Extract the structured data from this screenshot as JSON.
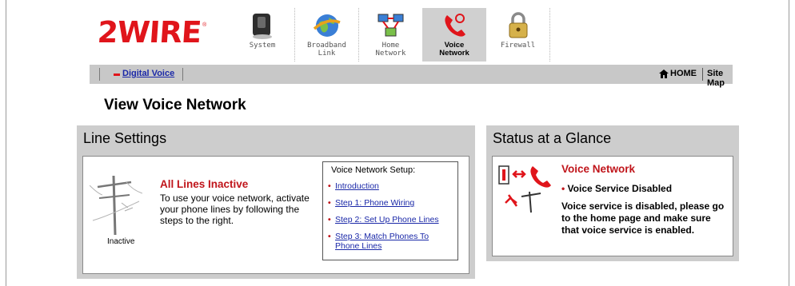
{
  "brand": {
    "logo_text": "2WIRE",
    "registered_mark": "®",
    "accent_color": "#e0151b"
  },
  "nav": {
    "tabs": [
      {
        "label_line1": "System",
        "label_line2": "",
        "icon": "system-icon",
        "active": false
      },
      {
        "label_line1": "Broadband",
        "label_line2": "Link",
        "icon": "globe-icon",
        "active": false
      },
      {
        "label_line1": "Home",
        "label_line2": "Network",
        "icon": "home-network-icon",
        "active": false
      },
      {
        "label_line1": "Voice",
        "label_line2": "Network",
        "icon": "phone-icon",
        "active": true
      },
      {
        "label_line1": "Firewall",
        "label_line2": "",
        "icon": "padlock-icon",
        "active": false
      }
    ]
  },
  "subnav": {
    "digital_voice": "Digital Voice",
    "home": "HOME",
    "site_map": "Site Map"
  },
  "page": {
    "title": "View Voice Network"
  },
  "line_settings": {
    "title": "Line Settings",
    "status_label": "Inactive",
    "heading": "All Lines Inactive",
    "body": "To use your voice network, activate your phone lines by following the steps to the right.",
    "setup": {
      "title": "Voice Network Setup:",
      "links": [
        "Introduction",
        "Step 1: Phone Wiring",
        "Step 2: Set Up Phone Lines",
        "Step 3: Match Phones To Phone Lines"
      ]
    }
  },
  "status": {
    "title": "Status at a Glance",
    "heading": "Voice Network",
    "bullet": "Voice Service Disabled",
    "body": "Voice service is disabled, please go to the home page and make sure that voice service is enabled."
  }
}
